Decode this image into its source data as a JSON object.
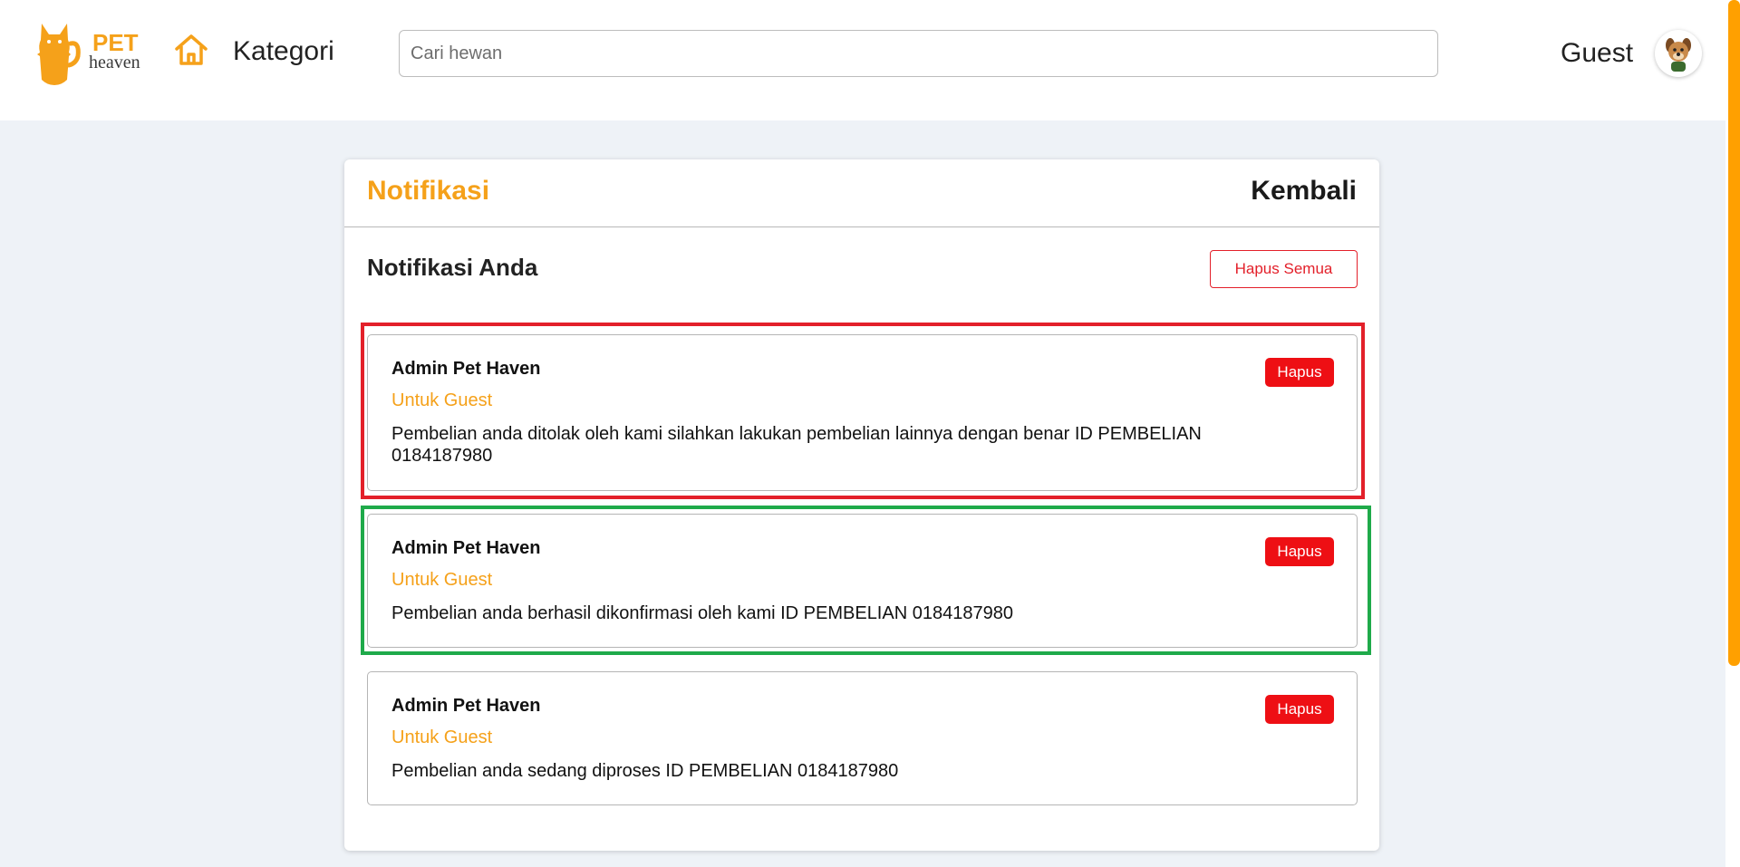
{
  "header": {
    "logo_text_top": "PET",
    "logo_text_bottom": "heaven",
    "nav_label": "Kategori",
    "search_placeholder": "Cari hewan",
    "user_name": "Guest",
    "icons": [
      "cat-logo-icon",
      "home-icon",
      "dog-avatar-icon"
    ]
  },
  "page": {
    "title": "Notifikasi",
    "back_label": "Kembali",
    "section_title": "Notifikasi Anda",
    "clear_all_label": "Hapus Semua"
  },
  "notifications": [
    {
      "sender": "Admin Pet Haven",
      "recipient": "Untuk Guest",
      "message": "Pembelian anda ditolak oleh kami silahkan lakukan pembelian lainnya dengan benar ID PEMBELIAN 0184187980",
      "delete_label": "Hapus"
    },
    {
      "sender": "Admin Pet Haven",
      "recipient": "Untuk Guest",
      "message": "Pembelian anda berhasil dikonfirmasi oleh kami ID PEMBELIAN 0184187980",
      "delete_label": "Hapus"
    },
    {
      "sender": "Admin Pet Haven",
      "recipient": "Untuk Guest",
      "message": "Pembelian anda sedang diproses ID PEMBELIAN 0184187980",
      "delete_label": "Hapus"
    }
  ],
  "colors": {
    "accent": "#f5a11a",
    "danger": "#ee0f14",
    "highlight_rejected": "#e3202a",
    "highlight_confirmed": "#1faa4a",
    "background": "#eef2f7"
  }
}
